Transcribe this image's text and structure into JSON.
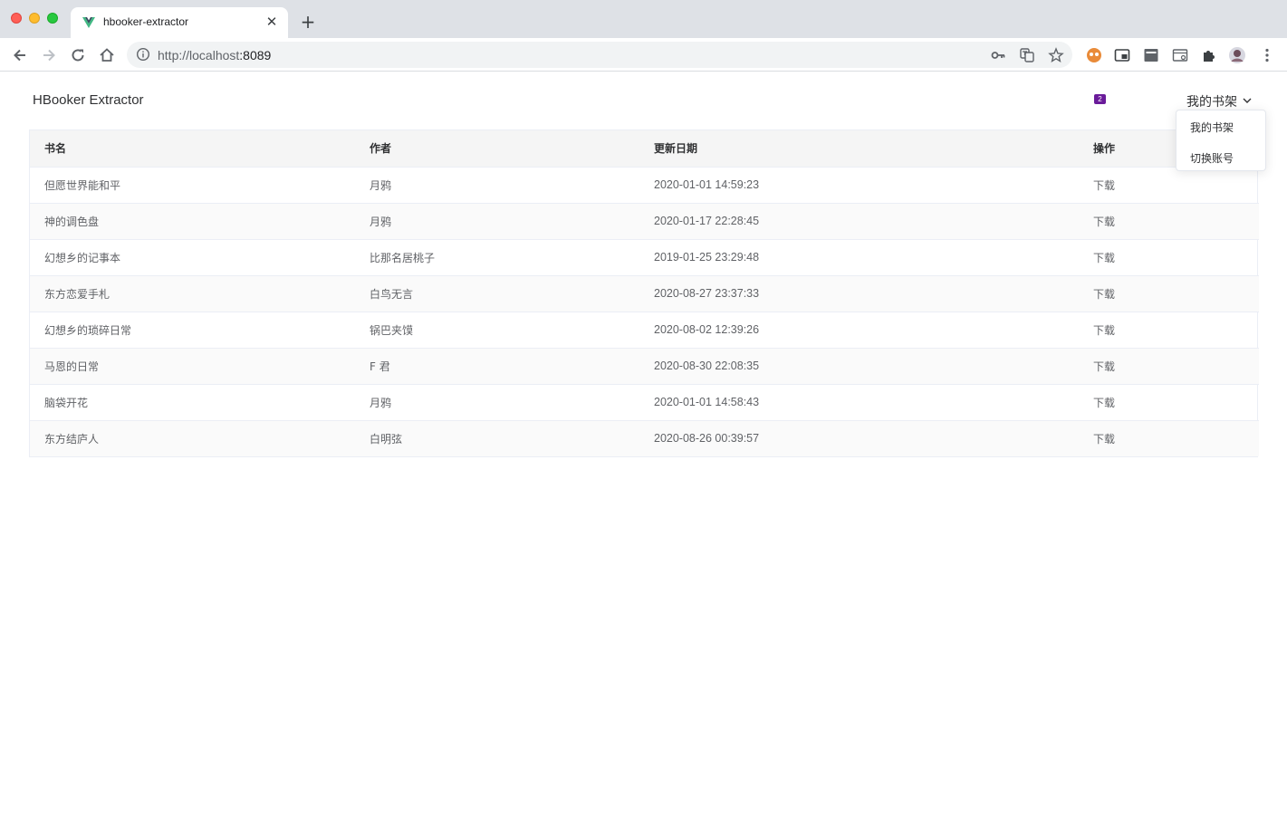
{
  "browser": {
    "tab_title": "hbooker-extractor",
    "close_glyph": "✕",
    "new_tab_glyph": "+",
    "url_host": "http://localhost",
    "url_port": ":8089",
    "extension_badge": "2",
    "accent_favicon": "#41b883"
  },
  "app": {
    "title": "HBooker Extractor",
    "menu_label": "我的书架",
    "dropdown": {
      "items": [
        "我的书架",
        "切换账号"
      ]
    }
  },
  "table": {
    "columns": [
      "书名",
      "作者",
      "更新日期",
      "操作"
    ],
    "rows": [
      {
        "name": "但愿世界能和平",
        "author": "月鸦",
        "date": "2020-01-01 14:59:23",
        "action": "下载"
      },
      {
        "name": "神的调色盘",
        "author": "月鸦",
        "date": "2020-01-17 22:28:45",
        "action": "下载"
      },
      {
        "name": "幻想乡的记事本",
        "author": "比那名居桃子",
        "date": "2019-01-25 23:29:48",
        "action": "下载"
      },
      {
        "name": "东方恋爱手札",
        "author": "白鸟无言",
        "date": "2020-08-27 23:37:33",
        "action": "下载"
      },
      {
        "name": "幻想乡的琐碎日常",
        "author": "锅巴夹馍",
        "date": "2020-08-02 12:39:26",
        "action": "下载"
      },
      {
        "name": "马恩的日常",
        "author": "F 君",
        "date": "2020-08-30 22:08:35",
        "action": "下载"
      },
      {
        "name": "脑袋开花",
        "author": "月鸦",
        "date": "2020-01-01 14:58:43",
        "action": "下载"
      },
      {
        "name": "东方结庐人",
        "author": "白明弦",
        "date": "2020-08-26 00:39:57",
        "action": "下载"
      }
    ]
  }
}
